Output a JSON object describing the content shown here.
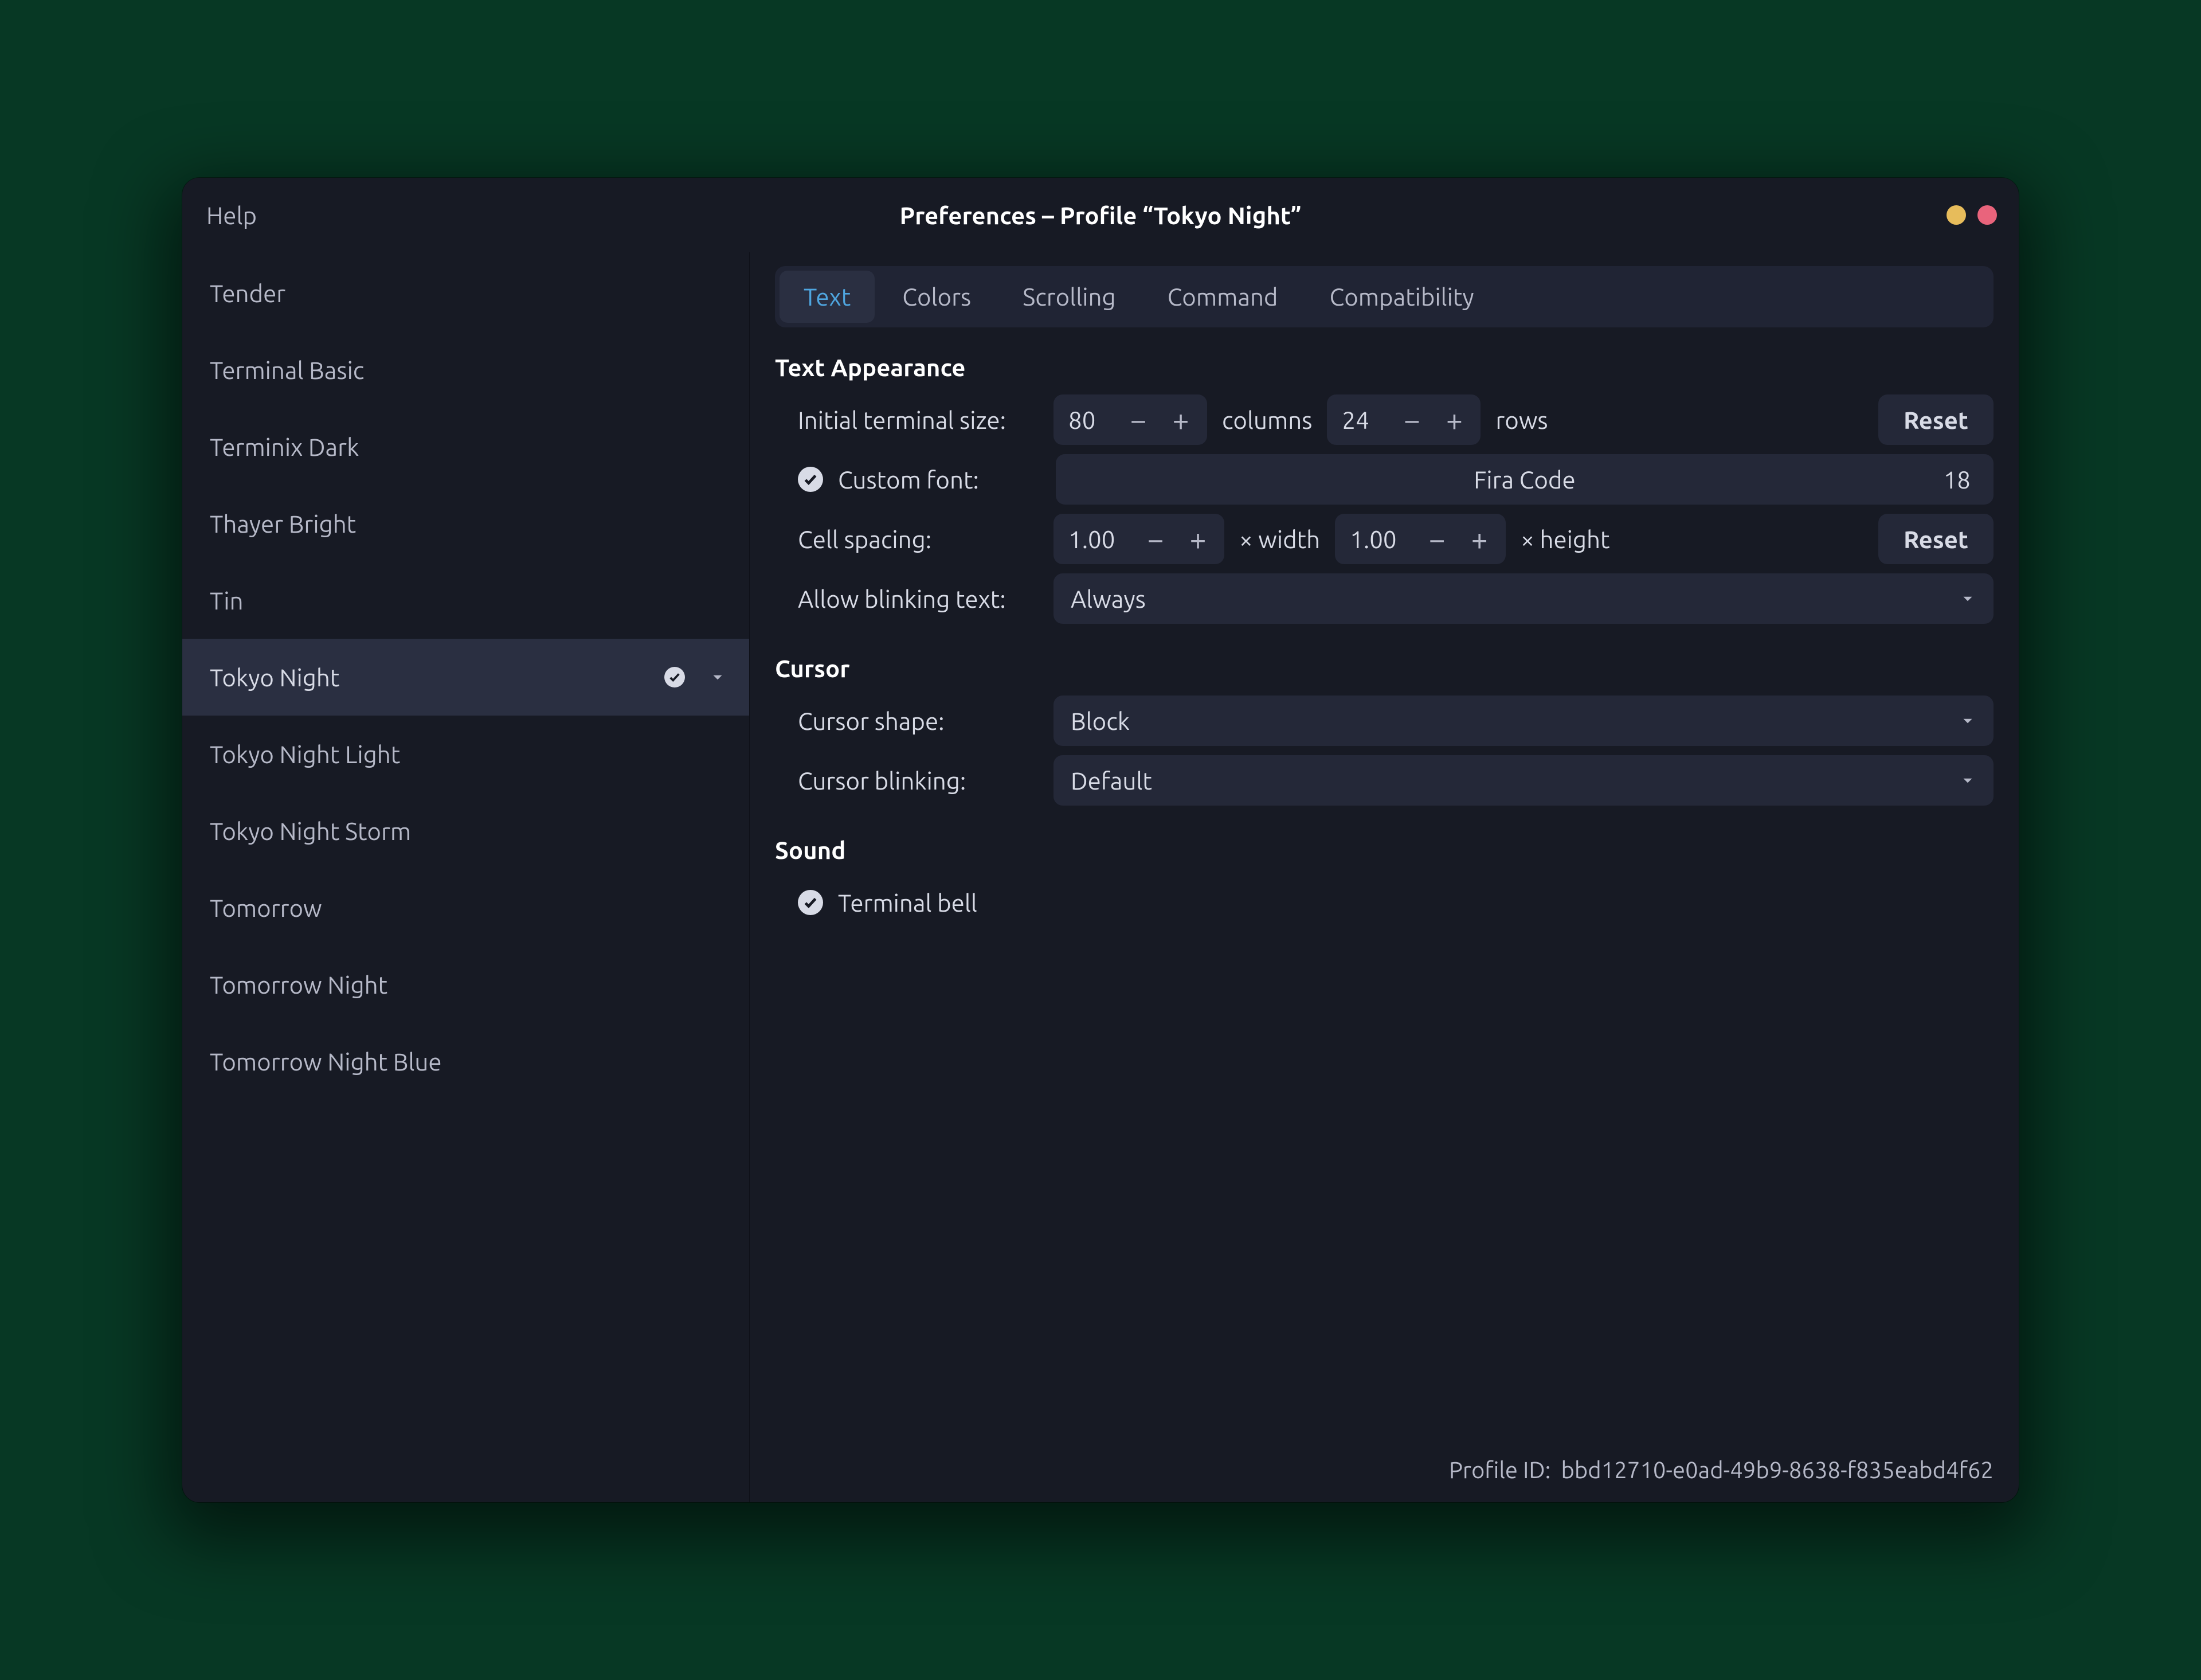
{
  "titlebar": {
    "help_label": "Help",
    "title": "Preferences – Profile “Tokyo Night”"
  },
  "sidebar": {
    "items": [
      {
        "label": "Tender"
      },
      {
        "label": "Terminal Basic"
      },
      {
        "label": "Terminix Dark"
      },
      {
        "label": "Thayer Bright"
      },
      {
        "label": "Tin"
      },
      {
        "label": "Tokyo Night",
        "selected": true
      },
      {
        "label": "Tokyo Night Light"
      },
      {
        "label": "Tokyo Night Storm"
      },
      {
        "label": "Tomorrow"
      },
      {
        "label": "Tomorrow Night"
      },
      {
        "label": "Tomorrow Night Blue"
      }
    ]
  },
  "tabs": [
    {
      "label": "Text",
      "active": true
    },
    {
      "label": "Colors",
      "active": false
    },
    {
      "label": "Scrolling",
      "active": false
    },
    {
      "label": "Command",
      "active": false
    },
    {
      "label": "Compatibility",
      "active": false
    }
  ],
  "sections": {
    "text_appearance": {
      "heading": "Text Appearance",
      "initial_size_label": "Initial terminal size:",
      "columns_value": "80",
      "columns_unit": "columns",
      "rows_value": "24",
      "rows_unit": "rows",
      "reset_label": "Reset",
      "custom_font_label": "Custom font:",
      "font_name": "Fira Code",
      "font_size": "18",
      "cell_spacing_label": "Cell spacing:",
      "width_value": "1.00",
      "width_unit": "× width",
      "height_value": "1.00",
      "height_unit": "× height",
      "cell_reset_label": "Reset",
      "blinking_label": "Allow blinking text:",
      "blinking_value": "Always"
    },
    "cursor": {
      "heading": "Cursor",
      "shape_label": "Cursor shape:",
      "shape_value": "Block",
      "blinking_label": "Cursor blinking:",
      "blinking_value": "Default"
    },
    "sound": {
      "heading": "Sound",
      "bell_label": "Terminal bell"
    }
  },
  "footer": {
    "id_label": "Profile ID:",
    "id_value": "bbd12710-e0ad-49b9-8638-f835eabd4f62"
  }
}
